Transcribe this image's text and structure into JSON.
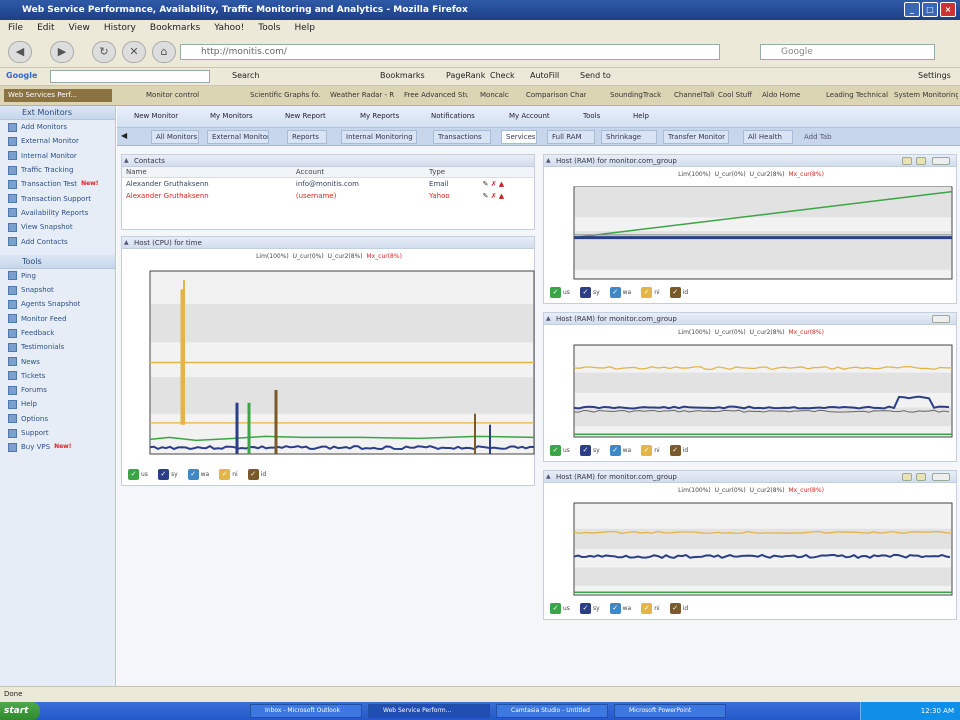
{
  "window": {
    "title": "Web Service Performance, Availability, Traffic Monitoring and Analytics - Mozilla Firefox"
  },
  "browser": {
    "menu": [
      "File",
      "Edit",
      "View",
      "History",
      "Bookmarks",
      "Yahoo!",
      "Tools",
      "Help"
    ],
    "url": "http://monitis.com/",
    "search_placeholder": "Google",
    "google_label": "Google",
    "toolbar_items": [
      "Search",
      "Bookmarks",
      "PageRank",
      "Check",
      "AutoFill",
      "Send to",
      "Settings"
    ],
    "bookmarks": [
      "Web Services Perf...",
      "Monitor control",
      "Scientific Graphs fo...",
      "Weather Radar - Rad...",
      "Free Advanced Stuff",
      "Moncalc",
      "Comparison Chart",
      "SoundingTrack",
      "ChannelTalk",
      "Cool Stuff",
      "",
      "Aldo Home",
      "Leading Technical Dev...",
      "System Monitoring T..."
    ]
  },
  "sidebar": {
    "header1": "Ext Monitors",
    "items1": [
      {
        "label": "Add Monitors",
        "badge": ""
      },
      {
        "label": "External Monitor",
        "badge": ""
      },
      {
        "label": "Internal Monitor",
        "badge": ""
      },
      {
        "label": "Traffic Tracking",
        "badge": ""
      },
      {
        "label": "Transaction Test",
        "badge": "New!"
      },
      {
        "label": "Transaction Support",
        "badge": ""
      },
      {
        "label": "Availability Reports",
        "badge": ""
      },
      {
        "label": "View Snapshot",
        "badge": ""
      },
      {
        "label": "Add Contacts",
        "badge": ""
      }
    ],
    "header2": "Tools",
    "items2": [
      {
        "label": "Ping",
        "badge": ""
      },
      {
        "label": "Snapshot",
        "badge": ""
      },
      {
        "label": "Agents Snapshot",
        "badge": ""
      },
      {
        "label": "Monitor Feed",
        "badge": ""
      },
      {
        "label": "Feedback",
        "badge": ""
      },
      {
        "label": "Testimonials",
        "badge": ""
      },
      {
        "label": "News",
        "badge": ""
      },
      {
        "label": "Tickets",
        "badge": ""
      },
      {
        "label": "Forums",
        "badge": ""
      },
      {
        "label": "Help",
        "badge": ""
      },
      {
        "label": "Options",
        "badge": ""
      },
      {
        "label": "Support",
        "badge": ""
      },
      {
        "label": "Buy VPS",
        "badge": "New!"
      }
    ]
  },
  "appmenu": [
    "New Monitor",
    "My Monitors",
    "New Report",
    "My Reports",
    "Notifications",
    "My Account",
    "Tools",
    "Help"
  ],
  "subtabs": [
    "All Monitors",
    "External Monitor",
    "Reports",
    "Internal Monitoring",
    "Transactions",
    "Services",
    "Full RAM",
    "Shrinkage",
    "Transfer Monitor",
    "All Health",
    "Add Tab"
  ],
  "contacts": {
    "title": "Contacts",
    "columns": [
      "Name",
      "Account",
      "Type"
    ],
    "rows": [
      {
        "name": "Alexander Gruthaksenn",
        "account": "info@monitis.com",
        "type": "Email",
        "color": "#334466"
      },
      {
        "name": "Alexander Gruthaksenn",
        "account": "(username)",
        "type": "Yahoo",
        "color": "#dd2222"
      }
    ]
  },
  "cpu_chart": {
    "title": "Host (CPU) for time",
    "stats": {
      "a": "Lim(100%)",
      "b": "U_cur(0%)",
      "c": "U_cur2(8%)",
      "d": "Mx_cur(8%)"
    }
  },
  "legend": [
    "us",
    "sy",
    "wa",
    "ni",
    "id"
  ],
  "charts_right": [
    {
      "title": "Host (RAM) for monitor.com_group",
      "stats": {
        "a": "Lim(100%)",
        "b": "U_cur(0%)",
        "c": "U_cur2(8%)",
        "d": "Mx_cur(8%)"
      }
    },
    {
      "title": "Host (RAM) for monitor.com_group",
      "stats": {
        "a": "Lim(100%)",
        "b": "U_cur(0%)",
        "c": "U_cur2(8%)",
        "d": "Mx_cur(8%)"
      }
    },
    {
      "title": "Host (RAM) for monitor.com_group",
      "stats": {
        "a": "Lim(100%)",
        "b": "U_cur(0%)",
        "c": "U_cur2(8%)",
        "d": "Mx_cur(8%)"
      }
    }
  ],
  "status": {
    "text": "Done"
  },
  "taskbar": {
    "start": "start",
    "items": [
      "Inbox - Microsoft Outlook",
      "Web Service Perform...",
      "Camtasia Studio - Untitled",
      "Microsoft PowerPoint"
    ],
    "clock": "12:30 AM"
  },
  "colors": {
    "us": "#3aa547",
    "sy": "#2b3f86",
    "wa": "#3f88c8",
    "ni": "#e3b548",
    "id": "#7a5a2a"
  }
}
